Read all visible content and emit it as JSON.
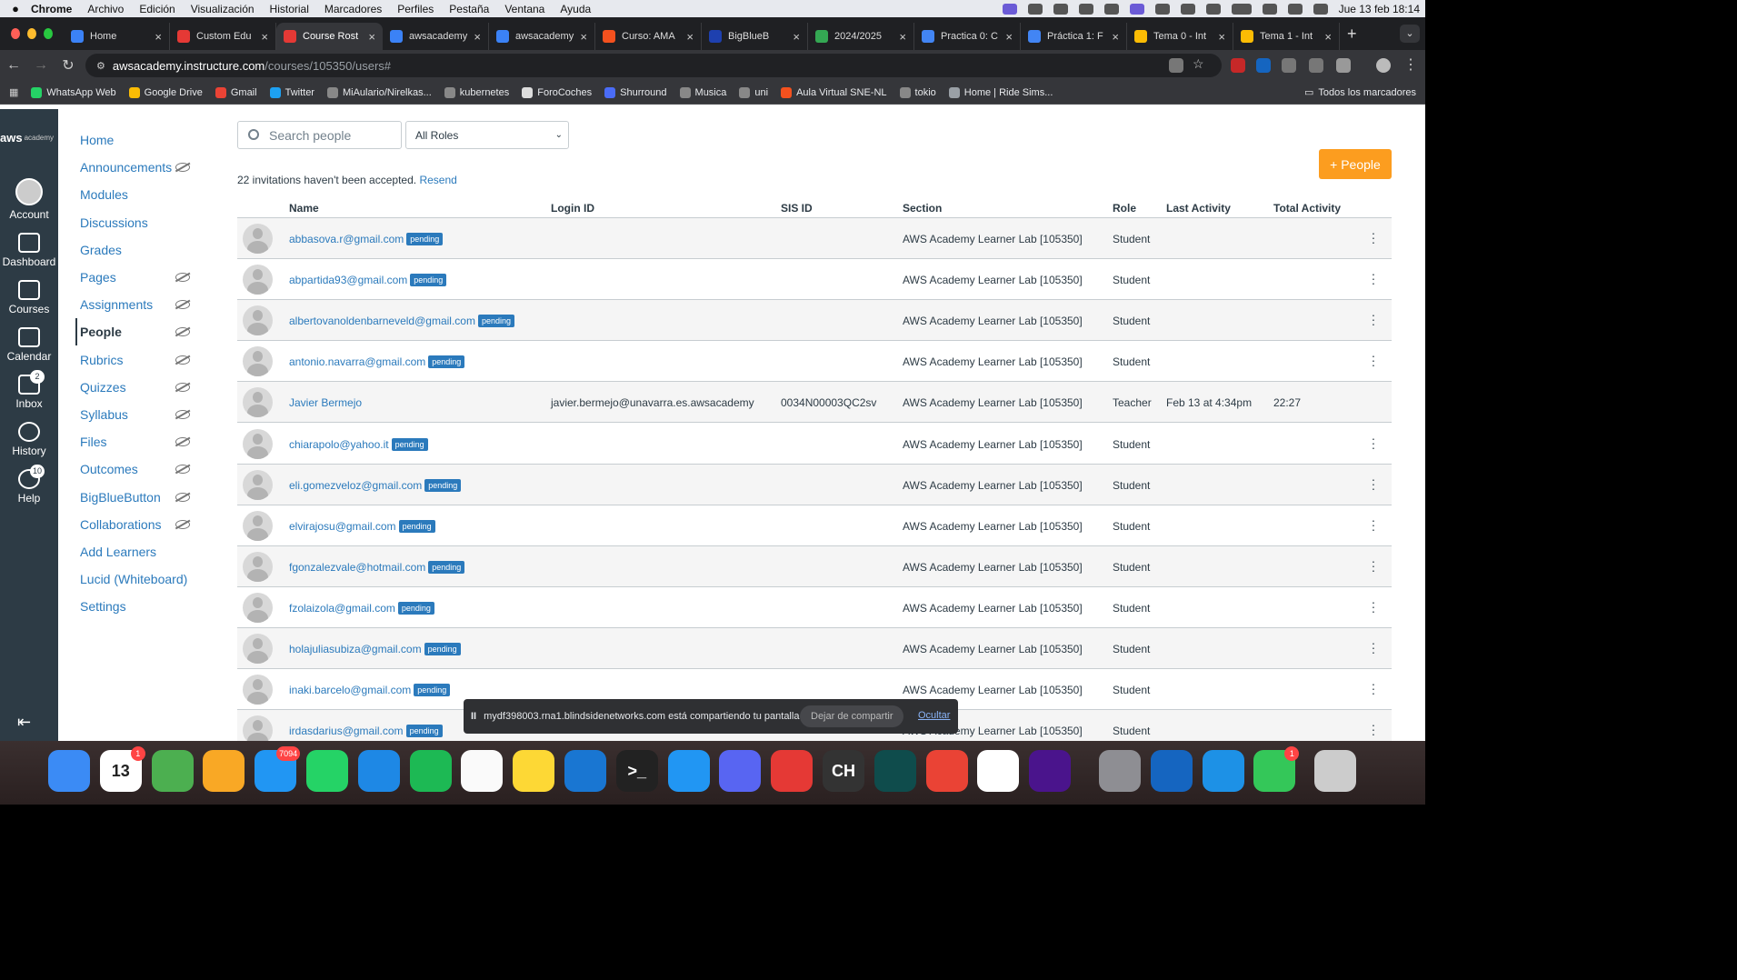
{
  "menubar": {
    "items": [
      "Chrome",
      "Archivo",
      "Edición",
      "Visualización",
      "Historial",
      "Marcadores",
      "Perfiles",
      "Pestaña",
      "Ventana",
      "Ayuda"
    ],
    "clock": "Jue 13 feb 18:14"
  },
  "tabs": [
    {
      "title": "Home",
      "color": "#3b82f6",
      "active": false
    },
    {
      "title": "Custom Edu",
      "color": "#e53935",
      "active": false
    },
    {
      "title": "Course Rost",
      "color": "#e53935",
      "active": true
    },
    {
      "title": "awsacademy",
      "color": "#3b82f6",
      "active": false
    },
    {
      "title": "awsacademy",
      "color": "#3b82f6",
      "active": false
    },
    {
      "title": "Curso: AMA",
      "color": "#f4511e",
      "active": false
    },
    {
      "title": "BigBlueB",
      "color": "#1e40af",
      "active": false
    },
    {
      "title": "2024/2025",
      "color": "#34a853",
      "active": false
    },
    {
      "title": "Practica 0: C",
      "color": "#4285f4",
      "active": false
    },
    {
      "title": "Práctica 1: F",
      "color": "#4285f4",
      "active": false
    },
    {
      "title": "Tema 0 - Int",
      "color": "#fbbc04",
      "active": false
    },
    {
      "title": "Tema 1 - Int",
      "color": "#fbbc04",
      "active": false
    }
  ],
  "address": {
    "host": "awsacademy.instructure.com",
    "path": "/courses/105350/users#"
  },
  "bookmarks": [
    {
      "label": "WhatsApp Web",
      "color": "#25d366"
    },
    {
      "label": "Google Drive",
      "color": "#fbbc04"
    },
    {
      "label": "Gmail",
      "color": "#ea4335"
    },
    {
      "label": "Twitter",
      "color": "#1da1f2"
    },
    {
      "label": "MiAulario/Nirelkas...",
      "color": "#888888"
    },
    {
      "label": "kubernetes",
      "color": "#888888"
    },
    {
      "label": "ForoCoches",
      "color": "#dddddd"
    },
    {
      "label": "Shurround",
      "color": "#4a6cf7"
    },
    {
      "label": "Musica",
      "color": "#888888"
    },
    {
      "label": "uni",
      "color": "#888888"
    },
    {
      "label": "Aula Virtual SNE-NL",
      "color": "#f4511e"
    },
    {
      "label": "tokio",
      "color": "#888888"
    },
    {
      "label": "Home | Ride Sims...",
      "color": "#9aa0a6"
    }
  ],
  "bookmarks_all": "Todos los marcadores",
  "global_nav": {
    "logo": "aws",
    "logo_sub": "academy",
    "items": [
      {
        "label": "Account",
        "badge": ""
      },
      {
        "label": "Dashboard",
        "badge": ""
      },
      {
        "label": "Courses",
        "badge": ""
      },
      {
        "label": "Calendar",
        "badge": ""
      },
      {
        "label": "Inbox",
        "badge": "2"
      },
      {
        "label": "History",
        "badge": ""
      },
      {
        "label": "Help",
        "badge": "10"
      }
    ]
  },
  "course_nav": [
    {
      "label": "Home",
      "hidden": false
    },
    {
      "label": "Announcements",
      "hidden": true
    },
    {
      "label": "Modules",
      "hidden": false
    },
    {
      "label": "Discussions",
      "hidden": false
    },
    {
      "label": "Grades",
      "hidden": false
    },
    {
      "label": "Pages",
      "hidden": true
    },
    {
      "label": "Assignments",
      "hidden": true
    },
    {
      "label": "People",
      "hidden": true,
      "active": true
    },
    {
      "label": "Rubrics",
      "hidden": true
    },
    {
      "label": "Quizzes",
      "hidden": true
    },
    {
      "label": "Syllabus",
      "hidden": true
    },
    {
      "label": "Files",
      "hidden": true
    },
    {
      "label": "Outcomes",
      "hidden": true
    },
    {
      "label": "BigBlueButton",
      "hidden": true
    },
    {
      "label": "Collaborations",
      "hidden": true
    },
    {
      "label": "Add Learners",
      "hidden": false
    },
    {
      "label": "Lucid (Whiteboard)",
      "hidden": false
    },
    {
      "label": "Settings",
      "hidden": false
    }
  ],
  "search": {
    "placeholder": "Search people"
  },
  "roles_filter": {
    "selected": "All Roles"
  },
  "add_people": {
    "label": "+ People"
  },
  "invitations": {
    "text": "22 invitations haven't been accepted.",
    "link": "Resend"
  },
  "table": {
    "headers": [
      "Name",
      "Login ID",
      "SIS ID",
      "Section",
      "Role",
      "Last Activity",
      "Total Activity"
    ],
    "pending_label": "pending",
    "rows": [
      {
        "name": "abbasova.r@gmail.com",
        "pending": true,
        "login": "",
        "sis": "",
        "section": "AWS Academy Learner Lab [105350]",
        "role": "Student",
        "last": "",
        "total": ""
      },
      {
        "name": "abpartida93@gmail.com",
        "pending": true,
        "login": "",
        "sis": "",
        "section": "AWS Academy Learner Lab [105350]",
        "role": "Student",
        "last": "",
        "total": ""
      },
      {
        "name": "albertovanoldenbarneveld@gmail.com",
        "pending": true,
        "login": "",
        "sis": "",
        "section": "AWS Academy Learner Lab [105350]",
        "role": "Student",
        "last": "",
        "total": ""
      },
      {
        "name": "antonio.navarra@gmail.com",
        "pending": true,
        "login": "",
        "sis": "",
        "section": "AWS Academy Learner Lab [105350]",
        "role": "Student",
        "last": "",
        "total": ""
      },
      {
        "name": "Javier Bermejo",
        "pending": false,
        "login": "javier.bermejo@unavarra.es.awsacademy",
        "sis": "0034N00003QC2sv",
        "section": "AWS Academy Learner Lab [105350]",
        "role": "Teacher",
        "last": "Feb 13 at 4:34pm",
        "total": "22:27"
      },
      {
        "name": "chiarapolo@yahoo.it",
        "pending": true,
        "login": "",
        "sis": "",
        "section": "AWS Academy Learner Lab [105350]",
        "role": "Student",
        "last": "",
        "total": ""
      },
      {
        "name": "eli.gomezveloz@gmail.com",
        "pending": true,
        "login": "",
        "sis": "",
        "section": "AWS Academy Learner Lab [105350]",
        "role": "Student",
        "last": "",
        "total": ""
      },
      {
        "name": "elvirajosu@gmail.com",
        "pending": true,
        "login": "",
        "sis": "",
        "section": "AWS Academy Learner Lab [105350]",
        "role": "Student",
        "last": "",
        "total": ""
      },
      {
        "name": "fgonzalezvale@hotmail.com",
        "pending": true,
        "login": "",
        "sis": "",
        "section": "AWS Academy Learner Lab [105350]",
        "role": "Student",
        "last": "",
        "total": ""
      },
      {
        "name": "fzolaizola@gmail.com",
        "pending": true,
        "login": "",
        "sis": "",
        "section": "AWS Academy Learner Lab [105350]",
        "role": "Student",
        "last": "",
        "total": ""
      },
      {
        "name": "holajuliasubiza@gmail.com",
        "pending": true,
        "login": "",
        "sis": "",
        "section": "AWS Academy Learner Lab [105350]",
        "role": "Student",
        "last": "",
        "total": ""
      },
      {
        "name": "inaki.barcelo@gmail.com",
        "pending": true,
        "login": "",
        "sis": "",
        "section": "AWS Academy Learner Lab [105350]",
        "role": "Student",
        "last": "",
        "total": ""
      },
      {
        "name": "irdasdarius@gmail.com",
        "pending": true,
        "login": "",
        "sis": "",
        "section": "AWS Academy Learner Lab [105350]",
        "role": "Student",
        "last": "",
        "total": ""
      }
    ]
  },
  "share_banner": {
    "text": "mydf398003.rna1.blindsidenetworks.com está compartiendo tu pantalla.",
    "stop": "Dejar de compartir",
    "hide": "Ocultar"
  },
  "dock": [
    {
      "name": "finder",
      "color": "#3b8bf5",
      "label": "",
      "badge": ""
    },
    {
      "name": "calendar",
      "color": "#ffffff",
      "label": "13",
      "badge": "1"
    },
    {
      "name": "maps",
      "color": "#4caf50",
      "label": "",
      "badge": ""
    },
    {
      "name": "photos",
      "color": "#f9a825",
      "label": "",
      "badge": ""
    },
    {
      "name": "mail",
      "color": "#2196f3",
      "label": "",
      "badge": "7094"
    },
    {
      "name": "whatsapp",
      "color": "#25d366",
      "label": "",
      "badge": ""
    },
    {
      "name": "safari",
      "color": "#1e88e5",
      "label": "",
      "badge": ""
    },
    {
      "name": "spotify",
      "color": "#1db954",
      "label": "",
      "badge": ""
    },
    {
      "name": "reminders",
      "color": "#fafafa",
      "label": "",
      "badge": ""
    },
    {
      "name": "notes",
      "color": "#fdd835",
      "label": "",
      "badge": ""
    },
    {
      "name": "vscode",
      "color": "#1976d2",
      "label": "",
      "badge": ""
    },
    {
      "name": "terminal",
      "color": "#222222",
      "label": ">_",
      "badge": ""
    },
    {
      "name": "app-store",
      "color": "#2196f3",
      "label": "",
      "badge": ""
    },
    {
      "name": "discord",
      "color": "#5865f2",
      "label": "",
      "badge": ""
    },
    {
      "name": "solitaire",
      "color": "#e53935",
      "label": "",
      "badge": ""
    },
    {
      "name": "ch",
      "color": "#333333",
      "label": "CH",
      "badge": ""
    },
    {
      "name": "perplexity",
      "color": "#0f4c4c",
      "label": "",
      "badge": ""
    },
    {
      "name": "chrome",
      "color": "#ea4335",
      "label": "",
      "badge": ""
    },
    {
      "name": "chatgpt",
      "color": "#ffffff",
      "label": "",
      "badge": ""
    },
    {
      "name": "cloud-app",
      "color": "#4a148c",
      "label": "",
      "badge": ""
    },
    {
      "name": "system-settings",
      "color": "#8e8e93",
      "label": "",
      "badge": ""
    },
    {
      "name": "github-desktop",
      "color": "#1565c0",
      "label": "",
      "badge": ""
    },
    {
      "name": "docker",
      "color": "#1d91e6",
      "label": "",
      "badge": ""
    },
    {
      "name": "facetime",
      "color": "#34c759",
      "label": "",
      "badge": "1"
    },
    {
      "name": "trash",
      "color": "#cccccc",
      "label": "",
      "badge": ""
    }
  ]
}
